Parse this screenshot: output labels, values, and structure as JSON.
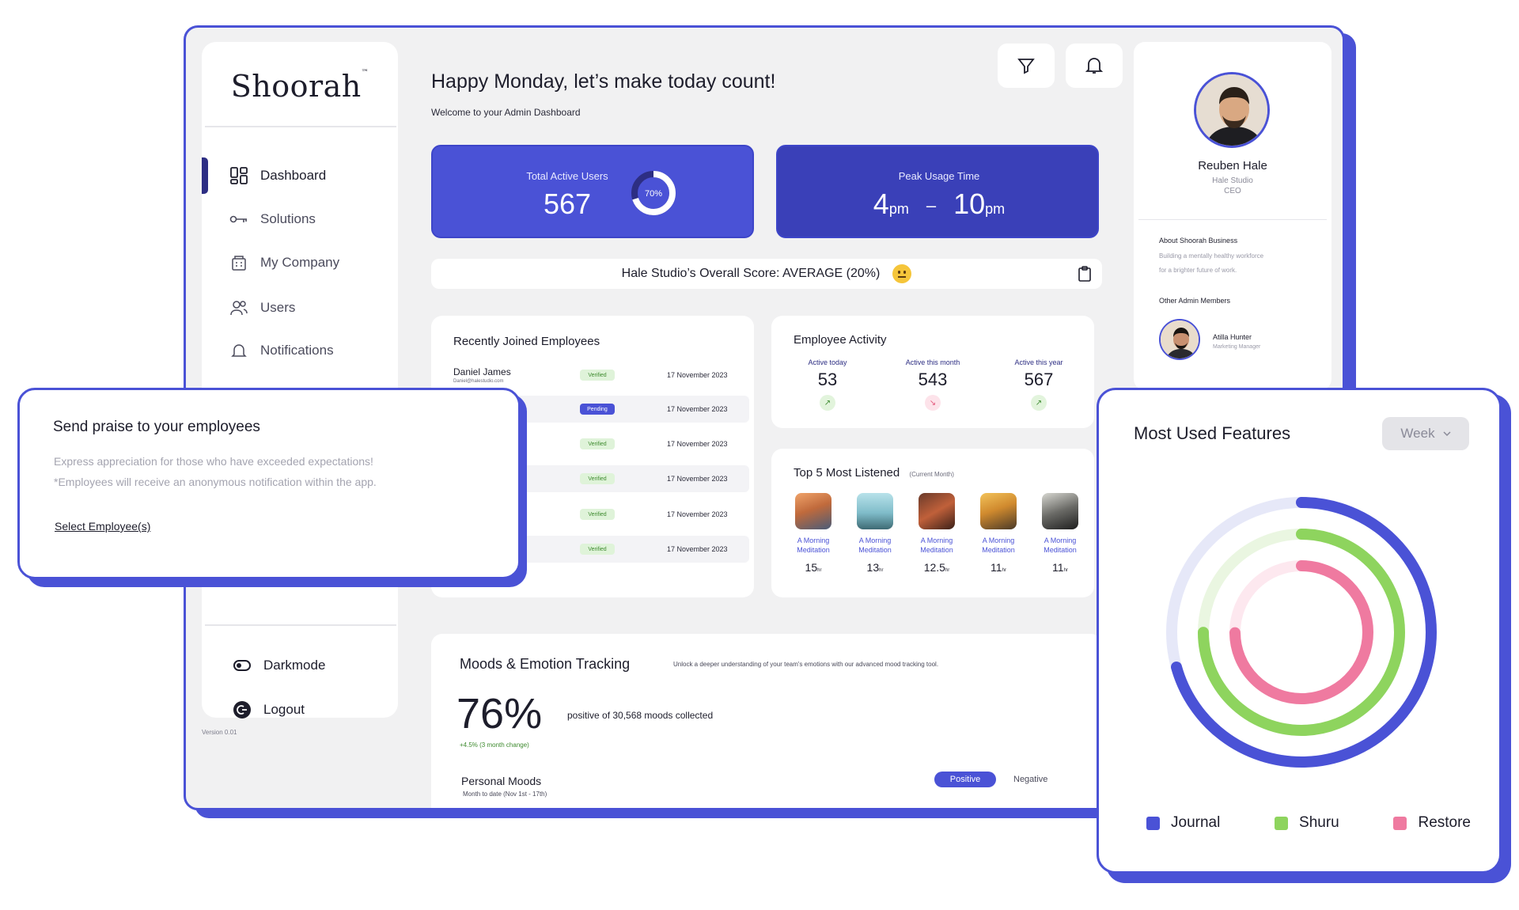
{
  "app": {
    "logo": "Shoorah",
    "version": "Version 0.01"
  },
  "sidebar": {
    "items": [
      {
        "label": "Dashboard",
        "icon": "dashboard-grid-icon"
      },
      {
        "label": "Solutions",
        "icon": "key-icon"
      },
      {
        "label": "My Company",
        "icon": "building-icon"
      },
      {
        "label": "Users",
        "icon": "users-icon"
      },
      {
        "label": "Notifications",
        "icon": "bell-icon"
      }
    ],
    "darkmode_label": "Darkmode",
    "logout_label": "Logout"
  },
  "header": {
    "greeting": "Happy Monday, let’s make today count!",
    "welcome": "Welcome to your Admin Dashboard"
  },
  "stats": {
    "total_active_users_label": "Total Active Users",
    "total_active_users_value": "567",
    "active_percent_label": "70%",
    "active_percent_value": 0.7,
    "peak_usage_label": "Peak Usage Time",
    "peak_start": "4",
    "peak_start_unit": "pm",
    "peak_separator": "–",
    "peak_end": "10",
    "peak_end_unit": "pm"
  },
  "score": {
    "text": "Hale Studio’s Overall Score: AVERAGE (20%)"
  },
  "recent": {
    "title": "Recently Joined Employees",
    "rows": [
      {
        "name": "Daniel James",
        "email": "Daniel@halestudio.com",
        "status": "Verified",
        "date": "17 November 2023"
      },
      {
        "name": "",
        "email": "",
        "status": "Pending",
        "date": "17 November 2023"
      },
      {
        "name": "",
        "email": "",
        "status": "Verified",
        "date": "17 November 2023"
      },
      {
        "name": "",
        "email": "",
        "status": "Verified",
        "date": "17 November 2023"
      },
      {
        "name": "",
        "email": "",
        "status": "Verified",
        "date": "17 November 2023"
      },
      {
        "name": "",
        "email": "",
        "status": "Verified",
        "date": "17 November 2023"
      }
    ]
  },
  "activity": {
    "title": "Employee Activity",
    "today_label": "Active today",
    "today_value": "53",
    "month_label": "Active this month",
    "month_value": "543",
    "year_label": "Active this year",
    "year_value": "567"
  },
  "top5": {
    "title": "Top 5 Most Listened",
    "subtitle": "(Current Month)",
    "items": [
      {
        "name_line1": "A Morning",
        "name_line2": "Meditation",
        "hours": "15",
        "unit": "hr"
      },
      {
        "name_line1": "A Morning",
        "name_line2": "Meditation",
        "hours": "13",
        "unit": "hr"
      },
      {
        "name_line1": "A Morning",
        "name_line2": "Meditation",
        "hours": "12.5",
        "unit": "hr"
      },
      {
        "name_line1": "A Morning",
        "name_line2": "Meditation",
        "hours": "11",
        "unit": "hr"
      },
      {
        "name_line1": "A Morning",
        "name_line2": "Meditation",
        "hours": "11",
        "unit": "hr"
      }
    ]
  },
  "moods": {
    "title": "Moods & Emotion Tracking",
    "description": "Unlock a deeper understanding of your team's emotions with our advanced mood tracking tool.",
    "percent": "76%",
    "collected": "positive of 30,568 moods collected",
    "change": "+4.5% (3 month change)",
    "personal_title": "Personal Moods",
    "personal_sub": "Month to date (Nov 1st - 17th)",
    "tab_positive": "Positive",
    "tab_negative": "Negative"
  },
  "profile": {
    "name": "Reuben Hale",
    "company": "Hale Studio",
    "role": "CEO",
    "about_title": "About Shoorah Business",
    "about_line1": "Building a mentally healthy workforce",
    "about_line2": "for a brighter future of work.",
    "admins_title": "Other Admin Members",
    "admin_name": "Atilla Hunter",
    "admin_role": "Marketing Manager"
  },
  "praise": {
    "title": "Send praise to your employees",
    "line1": "Express appreciation for those who have exceeded expectations!",
    "line2": "*Employees will receive an anonymous notification within the app.",
    "link": "Select Employee(s)"
  },
  "features": {
    "title": "Most Used Features",
    "period": "Week",
    "legend": [
      {
        "name": "Journal",
        "color": "#4a52d6"
      },
      {
        "name": "Shuru",
        "color": "#8ed45e"
      },
      {
        "name": "Restore",
        "color": "#ef7aa0"
      }
    ]
  },
  "colors": {
    "accent": "#4a52d6",
    "accent_dark": "#3a40b8",
    "verified": "#3d8a2e",
    "negative_trend": "#e2557a"
  }
}
